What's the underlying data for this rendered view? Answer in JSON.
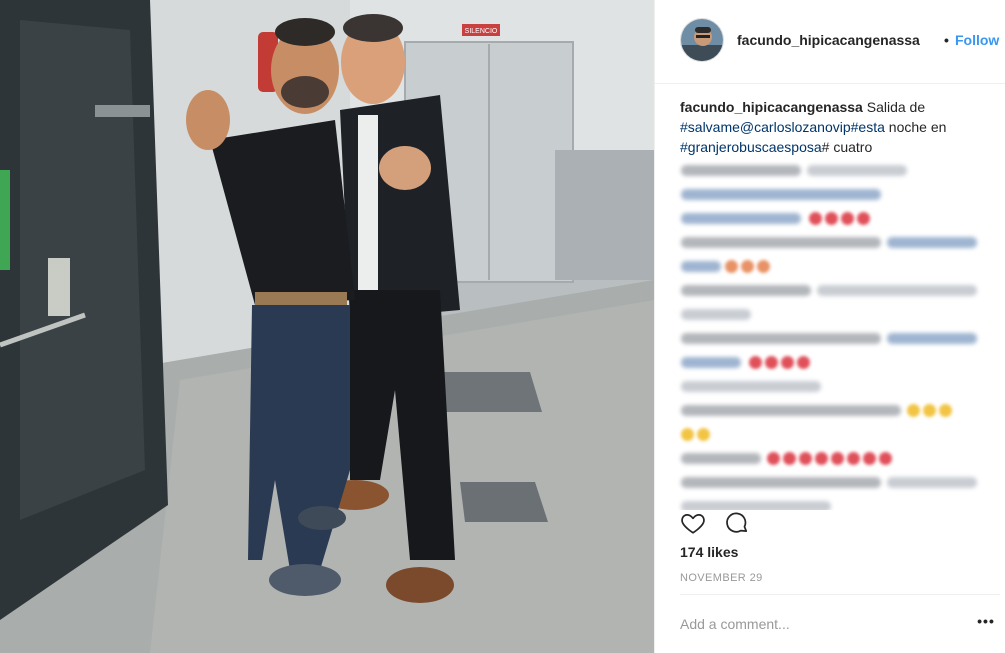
{
  "post": {
    "username": "facundo_hipicacangenassa",
    "separator": "•",
    "follow_label": "Follow"
  },
  "photo": {
    "sign_text": "SILENCIO"
  },
  "caption": {
    "username": "facundo_hipicacangenassa",
    "text_1": " Salida de ",
    "hashtag_1": "#salvame",
    "mention": "@carloslozanovip",
    "hashtag_2": "#esta",
    "text_2": " noche en ",
    "hashtag_3": "#granjerobuscaesposa",
    "text_3": "# cuatro"
  },
  "actions": {
    "like_icon": "heart-icon",
    "comment_icon": "comment-icon"
  },
  "likes": "174 likes",
  "date": "NOVEMBER 29",
  "add_comment": {
    "placeholder": "Add a comment..."
  },
  "more_label": "•••",
  "colors": {
    "link": "#3897f0",
    "hashtag": "#003569",
    "muted": "#999999",
    "border": "#efefef"
  }
}
